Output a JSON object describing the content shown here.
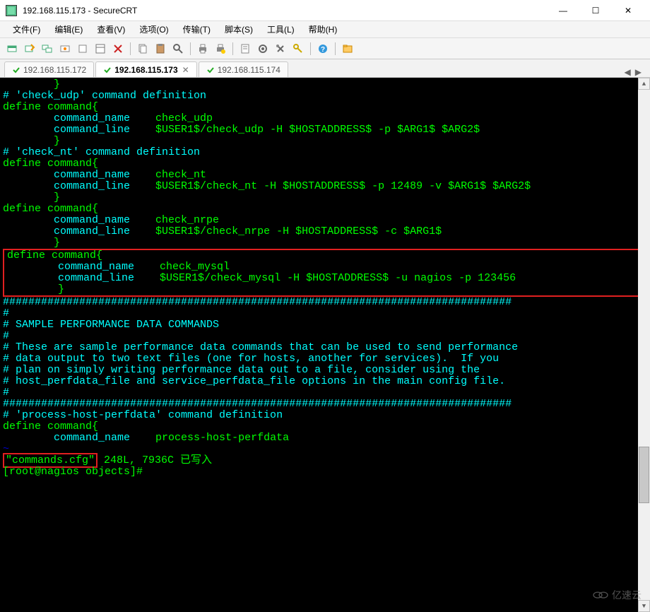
{
  "window": {
    "title": "192.168.115.173 - SecureCRT",
    "min_glyph": "—",
    "max_glyph": "☐",
    "close_glyph": "✕"
  },
  "menu": {
    "file": "文件(F)",
    "edit": "编辑(E)",
    "view": "查看(V)",
    "options": "选项(O)",
    "transfer": "传输(T)",
    "script": "脚本(S)",
    "tools": "工具(L)",
    "help": "帮助(H)"
  },
  "tabs": {
    "t1": "192.168.115.172",
    "t2": "192.168.115.173",
    "t3": "192.168.115.174",
    "close_glyph": "✕",
    "nav_left": "◀",
    "nav_right": "▶"
  },
  "terminal": {
    "line01": "        }",
    "line02": "",
    "line03": "",
    "line04": "# 'check_udp' command definition",
    "line05": "define command{",
    "line06_a": "        command_name    ",
    "line06_b": "check_udp",
    "line07_a": "        command_line    ",
    "line07_b": "$USER1$/check_udp -H $HOSTADDRESS$ -p $ARG1$ $ARG2$",
    "line08": "        }",
    "line09": "",
    "line10": "",
    "line11": "# 'check_nt' command definition",
    "line12": "define command{",
    "line13_a": "        command_name    ",
    "line13_b": "check_nt",
    "line14_a": "        command_line    ",
    "line14_b": "$USER1$/check_nt -H $HOSTADDRESS$ -p 12489 -v $ARG1$ $ARG2$",
    "line15": "        }",
    "line16": "",
    "line17": "define command{",
    "line18_a": "        command_name    ",
    "line18_b": "check_nrpe",
    "line19_a": "        command_line    ",
    "line19_b": "$USER1$/check_nrpe -H $HOSTADDRESS$ -c $ARG1$",
    "line20": "        }",
    "line21": "",
    "box_line1": "define command{",
    "box_line2_a": "        command_name    ",
    "box_line2_b": "check_mysql",
    "box_line3_a": "        command_line    ",
    "box_line3_b": "$USER1$/check_mysql -H $HOSTADDRESS$ -u nagios -p 123456",
    "box_line4": "        }",
    "line22": "",
    "sep1": "################################################################################",
    "sep_hash": "#",
    "sep_title": "# SAMPLE PERFORMANCE DATA COMMANDS",
    "sep_txt1": "# These are sample performance data commands that can be used to send performance",
    "sep_txt2": "# data output to two text files (one for hosts, another for services).  If you",
    "sep_txt3": "# plan on simply writing performance data out to a file, consider using the",
    "sep_txt4": "# host_perfdata_file and service_perfdata_file options in the main config file.",
    "line23": "",
    "line24": "",
    "line25": "# 'process-host-perfdata' command definition",
    "line26": "define command{",
    "line27_a": "        command_name    ",
    "line27_b": "process-host-perfdata",
    "fs_file": "\"commands.cfg\"",
    "fs_info": " 248L, 7936C 已写入",
    "prompt": "[root@nagios objects]#"
  },
  "watermark": "亿速云"
}
